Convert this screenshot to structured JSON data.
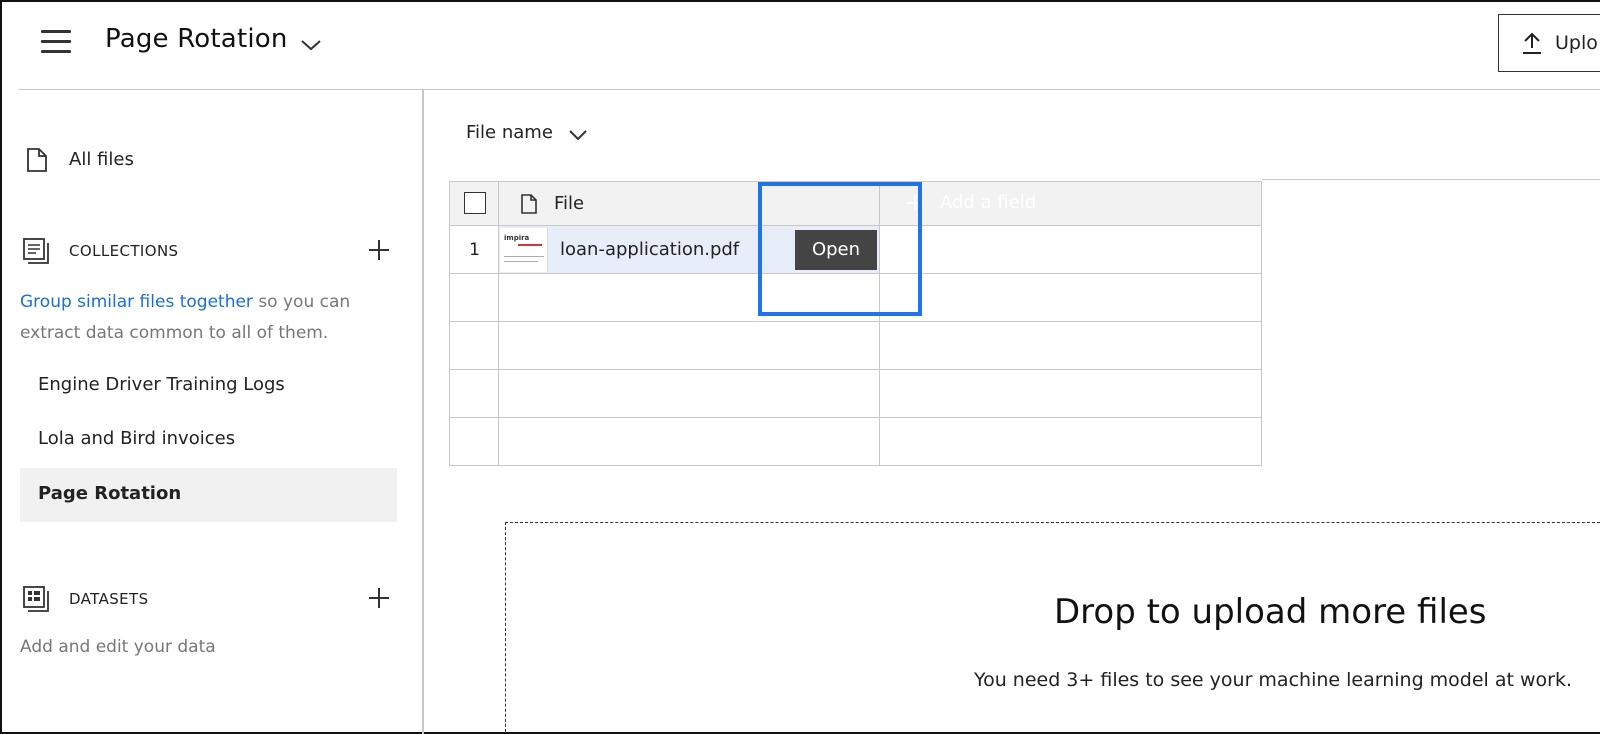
{
  "header": {
    "title": "Page Rotation",
    "upload_label": "Uplo"
  },
  "sidebar": {
    "all_files": "All files",
    "collections": {
      "heading": "COLLECTIONS",
      "hint_link": "Group similar files together",
      "hint_rest": " so you can extract data common to all of them.",
      "items": [
        {
          "label": "Engine Driver Training Logs"
        },
        {
          "label": "Lola and Bird invoices"
        },
        {
          "label": "Page Rotation",
          "active": true
        }
      ]
    },
    "datasets": {
      "heading": "DATASETS",
      "hint": "Add and edit your data"
    }
  },
  "main": {
    "sort_label": "File name",
    "table": {
      "file_header": "File",
      "add_field_label": "Add a field",
      "rows": [
        {
          "index": "1",
          "file_name": "loan-application.pdf",
          "open_label": "Open",
          "thumb_brand": "impira"
        }
      ],
      "empty_rows": 4
    },
    "drop": {
      "title": "Drop to upload more files",
      "subtitle": "You need 3+ files to see your machine learning model at work."
    }
  },
  "icons": {
    "menu": "hamburger-menu-icon",
    "chevron": "chevron-down-icon",
    "upload": "upload-icon",
    "file": "file-icon",
    "collections": "collections-icon",
    "datasets": "datasets-icon",
    "plus": "plus-icon"
  },
  "colors": {
    "link": "#1a6fd6",
    "focus": "#1e74e8",
    "add_field_bg": "#000000",
    "open_button_bg": "#444444",
    "selected_row": "#e8eef9"
  }
}
